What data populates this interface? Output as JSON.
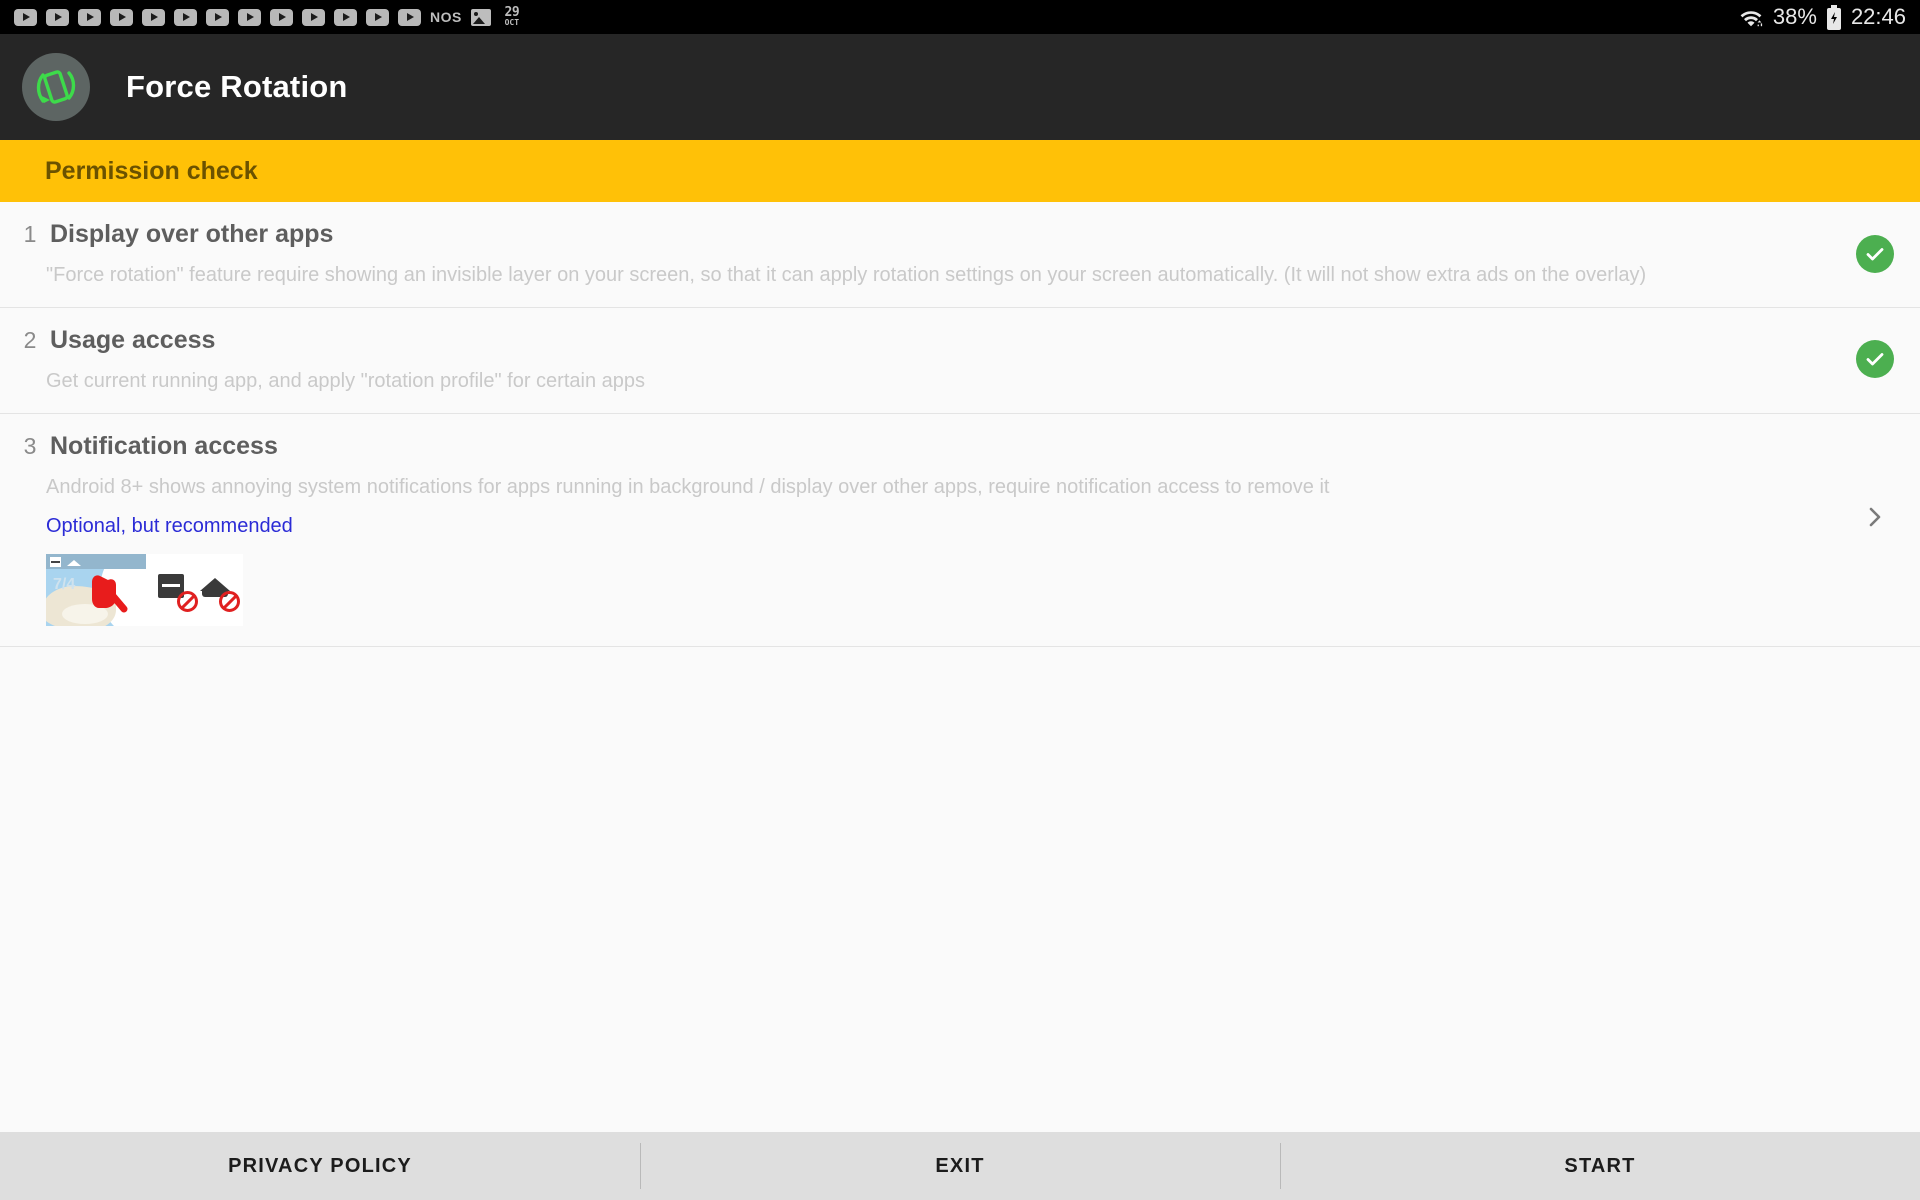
{
  "statusbar": {
    "play_badge_count": 13,
    "play_badge_icon": "youtube-play-icon",
    "nos_label": "NOS",
    "image_icon": "image-icon",
    "calendar_day": "29",
    "calendar_month": "OCT",
    "wifi_icon": "wifi-icon",
    "battery_percent": "38%",
    "battery_icon": "battery-charging-icon",
    "clock": "22:46"
  },
  "appbar": {
    "logo_icon": "force-rotation-logo-icon",
    "title": "Force Rotation"
  },
  "banner": {
    "title": "Permission check",
    "background_color": "#FFC107",
    "text_color": "#6b5200"
  },
  "permissions": [
    {
      "number": "1",
      "title": "Display over other apps",
      "description": "\"Force rotation\" feature require showing an invisible layer on your screen, so that it can apply rotation settings on your screen automatically. (It will not show extra ads on the overlay)",
      "status": "granted",
      "status_icon": "check-circle-icon"
    },
    {
      "number": "2",
      "title": "Usage access",
      "description": "Get current running app, and apply \"rotation profile\" for certain apps",
      "status": "granted",
      "status_icon": "check-circle-icon"
    },
    {
      "number": "3",
      "title": "Notification access",
      "description": "Android 8+ shows annoying system notifications for apps running in background / display over other apps, require notification access to remove it",
      "optional_note": "Optional, but recommended",
      "status": "pending",
      "status_icon": "chevron-right-icon",
      "thumbnail": {
        "map_label": "7/4",
        "map_icon_1": "chart-icon",
        "map_icon_2": "layers-icon",
        "pointer_icon": "red-pointing-hand-icon",
        "disabled_icon_1": "chart-disabled-icon",
        "disabled_icon_2": "layers-disabled-icon"
      }
    }
  ],
  "colors": {
    "accent_green": "#4CAF50",
    "banner_yellow": "#FFC107",
    "link_blue": "#2b2bd6",
    "appbar_dark": "#262626",
    "page_background": "#FAFAFA",
    "bottombar": "#DEDEDE"
  },
  "bottombar": {
    "privacy_policy": "PRIVACY POLICY",
    "exit": "EXIT",
    "start": "START"
  }
}
